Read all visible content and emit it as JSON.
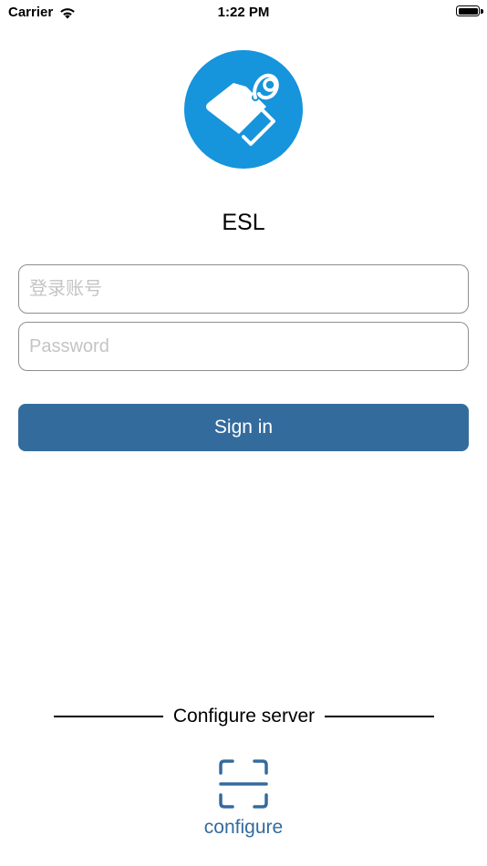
{
  "status_bar": {
    "carrier": "Carrier",
    "time": "1:22 PM",
    "wifi_icon": "wifi-icon",
    "battery_icon": "battery-icon"
  },
  "app": {
    "logo_icon": "price-tag-icon",
    "title": "ESL"
  },
  "login_form": {
    "account_placeholder": "登录账号",
    "account_value": "",
    "password_placeholder": "Password",
    "password_value": "",
    "sign_in_label": "Sign in"
  },
  "server": {
    "section_label": "Configure server",
    "configure_icon": "scan-frame-icon",
    "configure_label": "configure"
  },
  "colors": {
    "logo_blue": "#1694dc",
    "primary": "#346b9d",
    "field_border": "#8e8e8e",
    "placeholder": "#c4c4c6"
  }
}
